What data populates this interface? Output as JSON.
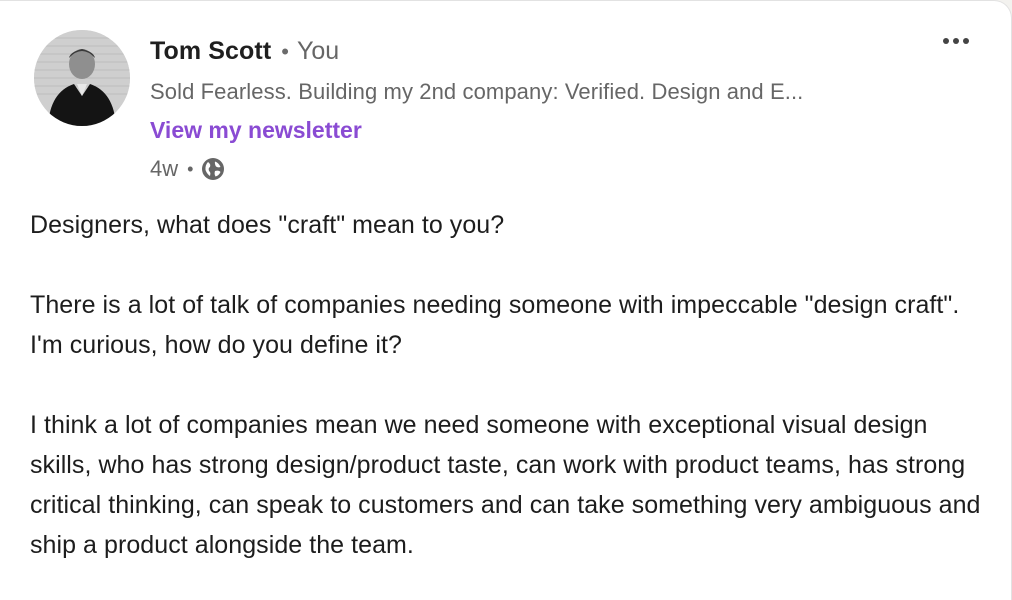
{
  "author": {
    "name": "Tom Scott",
    "separator": "•",
    "degree": "You",
    "headline": "Sold Fearless. Building my 2nd company: Verified. Design and E...",
    "newsletter_link": "View my newsletter",
    "post_age": "4w",
    "meta_separator": "•",
    "visibility_icon": "globe-icon"
  },
  "menu": {
    "more_icon": "more-horizontal-icon"
  },
  "post": {
    "paragraphs": [
      "Designers, what does \"craft\" mean to you?",
      "There is a lot of talk of companies needing someone with impeccable \"design craft\". I'm curious, how do you define it?",
      "I think a lot of companies mean we need someone with exceptional visual design skills, who has strong design/product taste, can work with product teams, has strong critical thinking, can speak to customers and can take something very ambiguous and ship a product alongside the team."
    ]
  },
  "colors": {
    "link": "#8a4bd3",
    "name": "#1f1f1f",
    "secondary_text": "#666666",
    "body_text": "#1d1d1d",
    "card_background": "#ffffff"
  }
}
